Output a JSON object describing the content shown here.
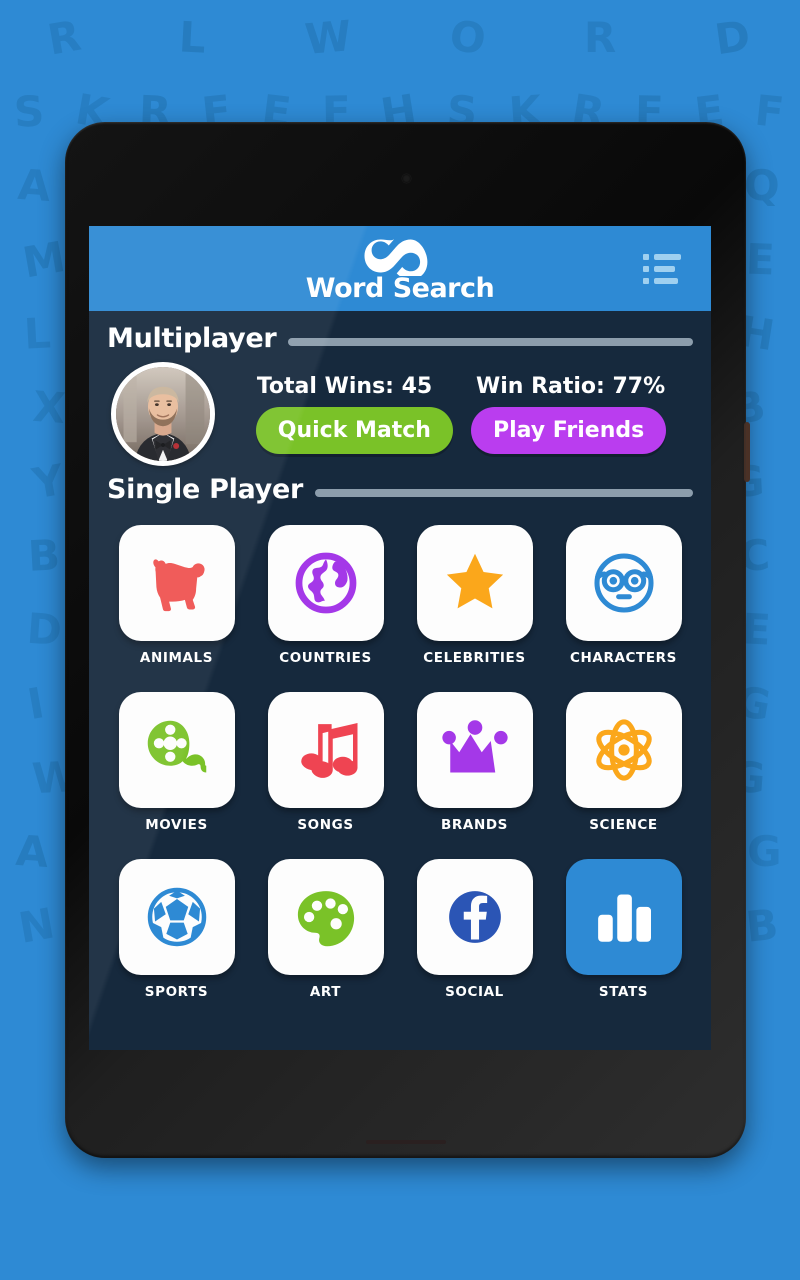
{
  "background": {
    "color": "#2E8AD4",
    "letter_color": "#2579BA",
    "letter_rows": [
      "R L W O R D",
      "S K R F E F H S K R F E F",
      "A E T A I C T A I C T Q",
      "M K O A S E D O I E",
      "L E T M E R O I A H",
      "X F K E R V O B",
      "Y Q Z E T W I G",
      "B P L O R E S A C",
      "D S E A R C H N E",
      "I M T U K A L G G",
      "W A Y R E F G G",
      "A D C F G A B A D C F G",
      "N O P H R I M S E K B"
    ]
  },
  "device": {
    "type": "tablet",
    "bezel_color": "#0e0e0e"
  },
  "app": {
    "header": {
      "title": "Word Search",
      "logo_icon": "infinity-icon",
      "menu_icon": "list-menu-icon",
      "background_color": "#2E8AD4"
    },
    "screen_background": "#16293D",
    "multiplayer": {
      "section_title": "Multiplayer",
      "avatar_icon": "user-photo-avatar",
      "stats": [
        {
          "label": "Total Wins: 45"
        },
        {
          "label": "Win Ratio: 77%"
        }
      ],
      "buttons": [
        {
          "label": "Quick Match",
          "color": "#7AC228"
        },
        {
          "label": "Play Friends",
          "color": "#BA3DEF"
        }
      ]
    },
    "single_player": {
      "section_title": "Single Player",
      "categories": [
        {
          "label": "ANIMALS",
          "icon": "dog-icon",
          "color": "#EF5350",
          "tile": "white"
        },
        {
          "label": "COUNTRIES",
          "icon": "globe-icon",
          "color": "#A438E8",
          "tile": "white"
        },
        {
          "label": "CELEBRITIES",
          "icon": "star-icon",
          "color": "#FBA71B",
          "tile": "white"
        },
        {
          "label": "CHARACTERS",
          "icon": "nerd-face-icon",
          "color": "#2E8AD4",
          "tile": "white"
        },
        {
          "label": "MOVIES",
          "icon": "film-reel-icon",
          "color": "#7AC228",
          "tile": "white"
        },
        {
          "label": "SONGS",
          "icon": "music-notes-icon",
          "color": "#EF4452",
          "tile": "white"
        },
        {
          "label": "BRANDS",
          "icon": "crown-icon",
          "color": "#A438E8",
          "tile": "white"
        },
        {
          "label": "SCIENCE",
          "icon": "atom-icon",
          "color": "#FBA71B",
          "tile": "white"
        },
        {
          "label": "SPORTS",
          "icon": "soccer-ball-icon",
          "color": "#2E8AD4",
          "tile": "white"
        },
        {
          "label": "ART",
          "icon": "palette-icon",
          "color": "#7AC228",
          "tile": "white"
        },
        {
          "label": "SOCIAL",
          "icon": "facebook-icon",
          "color": "#2B55B5",
          "tile": "white"
        },
        {
          "label": "STATS",
          "icon": "bar-chart-icon",
          "color": "#FFFFFF",
          "tile": "accent"
        }
      ]
    }
  }
}
